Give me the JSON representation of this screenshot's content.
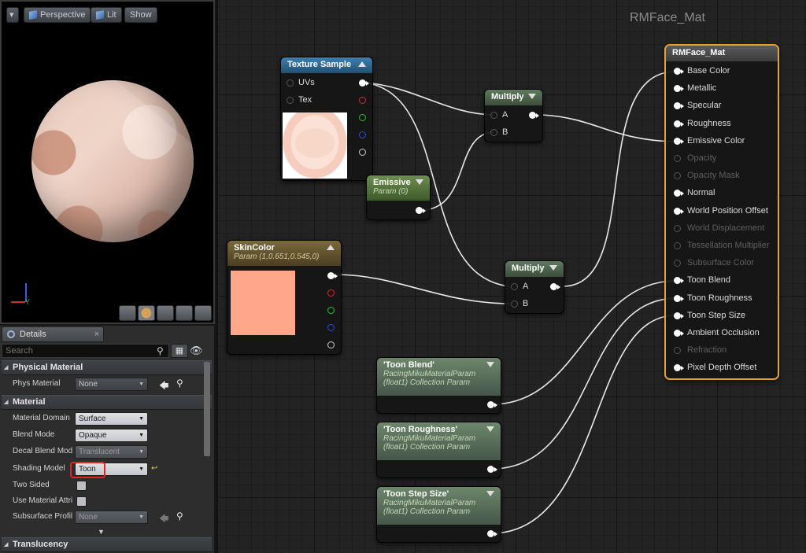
{
  "viewport": {
    "menu_icon": "dropdown-arrow-icon",
    "perspective_label": "Perspective",
    "lit_label": "Lit",
    "show_label": "Show",
    "axis_y": "Y",
    "preview_tools": [
      "cylinder-icon",
      "sphere-icon",
      "plane-icon",
      "cube-icon",
      "mesh-icon"
    ]
  },
  "details": {
    "tab_label": "Details",
    "search_placeholder": "Search",
    "categories": {
      "physical_material": "Physical Material",
      "material": "Material",
      "translucency": "Translucency"
    },
    "phys_material": {
      "label": "Phys Material",
      "value": "None"
    },
    "material_domain": {
      "label": "Material Domain",
      "value": "Surface"
    },
    "blend_mode": {
      "label": "Blend Mode",
      "value": "Opaque"
    },
    "decal_blend_mode": {
      "label": "Decal Blend Mode",
      "value": "Translucent"
    },
    "shading_model": {
      "label": "Shading Model",
      "value": "Toon"
    },
    "two_sided": {
      "label": "Two Sided",
      "checked": false
    },
    "use_material_attr": {
      "label": "Use Material Attributes",
      "checked": false
    },
    "subsurface_profile": {
      "label": "Subsurface Profile",
      "value": "None"
    }
  },
  "graph": {
    "title": "RMFace_Mat",
    "texture_sample": {
      "title": "Texture Sample",
      "pins": [
        "UVs",
        "Tex"
      ]
    },
    "multiply1": {
      "title": "Multiply",
      "pins": [
        "A",
        "B"
      ]
    },
    "multiply2": {
      "title": "Multiply",
      "pins": [
        "A",
        "B"
      ]
    },
    "emissive": {
      "title": "Emissive",
      "subtitle": "Param (0)"
    },
    "skincolor": {
      "title": "SkinColor",
      "subtitle": "Param (1,0.651,0.545,0)",
      "color": "#ffa68b"
    },
    "toon_blend": {
      "title": "'Toon Blend'",
      "sub1": "RacingMikuMaterialParam",
      "sub2": "(float1) Collection Param"
    },
    "toon_roughness": {
      "title": "'Toon Roughness'",
      "sub1": "RacingMikuMaterialParam",
      "sub2": "(float1) Collection Param"
    },
    "toon_step": {
      "title": "'Toon Step Size'",
      "sub1": "RacingMikuMaterialParam",
      "sub2": "(float1) Collection Param"
    },
    "material_node": {
      "title": "RMFace_Mat",
      "border_color": "#e8a030",
      "inputs": [
        {
          "label": "Base Color",
          "active": true
        },
        {
          "label": "Metallic",
          "active": true
        },
        {
          "label": "Specular",
          "active": true
        },
        {
          "label": "Roughness",
          "active": true
        },
        {
          "label": "Emissive Color",
          "active": true
        },
        {
          "label": "Opacity",
          "active": false
        },
        {
          "label": "Opacity Mask",
          "active": false
        },
        {
          "label": "Normal",
          "active": true
        },
        {
          "label": "World Position Offset",
          "active": true
        },
        {
          "label": "World Displacement",
          "active": false
        },
        {
          "label": "Tessellation Multiplier",
          "active": false
        },
        {
          "label": "Subsurface Color",
          "active": false
        },
        {
          "label": "Toon Blend",
          "active": true
        },
        {
          "label": "Toon Roughness",
          "active": true
        },
        {
          "label": "Toon Step Size",
          "active": true
        },
        {
          "label": "Ambient Occlusion",
          "active": true
        },
        {
          "label": "Refraction",
          "active": false
        },
        {
          "label": "Pixel Depth Offset",
          "active": true
        }
      ]
    }
  }
}
